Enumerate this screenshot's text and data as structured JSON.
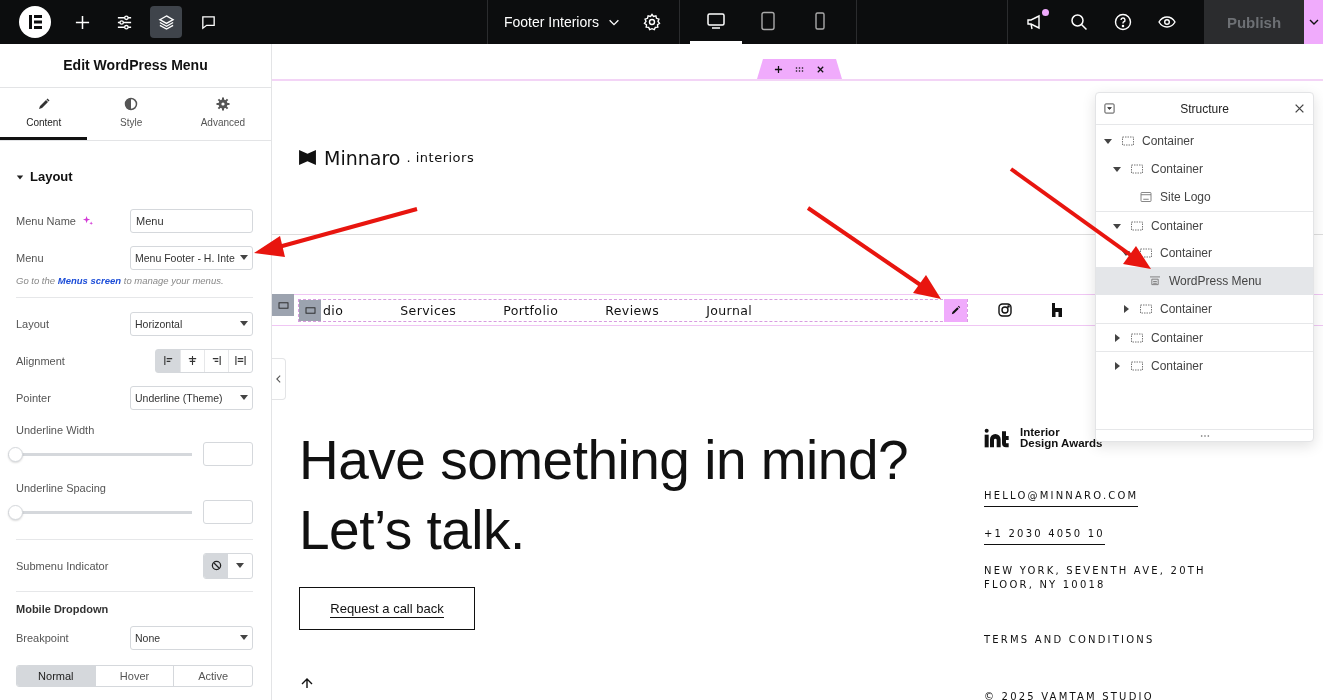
{
  "topbar": {
    "tools": [
      {
        "kind": "add",
        "selected": false
      },
      {
        "kind": "settings",
        "selected": false
      },
      {
        "kind": "layers",
        "selected": true
      },
      {
        "kind": "comments",
        "selected": false
      }
    ],
    "document": {
      "title": "Footer Interiors"
    },
    "devices": [
      {
        "kind": "desktop",
        "selected": true
      },
      {
        "kind": "tablet",
        "selected": false
      },
      {
        "kind": "mobile",
        "selected": false
      }
    ],
    "whats_new": {
      "unread": true
    },
    "publish": {
      "label": "Publish",
      "disabled": true
    }
  },
  "panel": {
    "title": "Edit WordPress Menu",
    "tabs": [
      {
        "label": "Content",
        "kind": "content",
        "selected": true
      },
      {
        "label": "Style",
        "kind": "style",
        "selected": false
      },
      {
        "label": "Advanced",
        "kind": "advanced",
        "selected": false
      }
    ],
    "section": {
      "title": "Layout",
      "expanded": true
    },
    "groups": [
      [
        {
          "kind": "input",
          "label": "Menu Name",
          "ai": true,
          "value": "Menu"
        },
        {
          "kind": "select",
          "label": "Menu",
          "value": "Menu Footer - H. Inte"
        },
        {
          "kind": "hint",
          "before": "Go to the",
          "link": "Menus screen",
          "after": "to manage your menus."
        }
      ],
      [
        {
          "kind": "select",
          "label": "Layout",
          "value": "Horizontal"
        },
        {
          "kind": "align",
          "label": "Alignment",
          "options": [
            {
              "kind": "left",
              "selected": true
            },
            {
              "kind": "center",
              "selected": false
            },
            {
              "kind": "right",
              "selected": false
            },
            {
              "kind": "justify",
              "selected": false
            }
          ]
        },
        {
          "kind": "select",
          "label": "Pointer",
          "value": "Underline (Theme)"
        },
        {
          "kind": "slider",
          "label": "Underline Width",
          "level": 0
        },
        {
          "kind": "slider",
          "label": "Underline Spacing",
          "level": 0
        }
      ],
      [
        {
          "kind": "indicator",
          "label": "Submenu Indicator"
        }
      ],
      [
        {
          "kind": "heading",
          "label": "Mobile Dropdown"
        },
        {
          "kind": "select",
          "label": "Breakpoint",
          "value": "None"
        },
        {
          "kind": "segments",
          "options": [
            {
              "label": "Normal",
              "selected": true
            },
            {
              "label": "Hover",
              "selected": false
            },
            {
              "label": "Active",
              "selected": false
            }
          ]
        }
      ]
    ]
  },
  "site": {
    "logo": {
      "name": "Minnaro",
      "suffix": ". interiors"
    },
    "menu": {
      "items": [
        "dio",
        "Services",
        "Portfolio",
        "Reviews",
        "Journal"
      ],
      "socials": [
        {
          "kind": "instagram"
        },
        {
          "kind": "houzz"
        }
      ]
    },
    "headline": "Have something in mind? Let’s talk.",
    "cta": "Request a call back",
    "award": [
      "Interior",
      "Design Awards"
    ],
    "email": "HELLO@MINNARO.COM",
    "phone": "+1 2030 4050 10",
    "address": [
      "NEW YORK, SEVENTH AVE, 20TH",
      "FLOOR, NY 10018"
    ],
    "terms": "TERMS AND CONDITIONS",
    "copyright": "© 2025 VAMTAM STUDIO"
  },
  "structure": {
    "title": "Structure",
    "tree": [
      {
        "label": "Container",
        "kind": "container",
        "expanded": true,
        "selected": false,
        "children": [
          {
            "label": "Container",
            "kind": "container",
            "expanded": true,
            "selected": false,
            "children": [
              {
                "label": "Site Logo",
                "kind": "logo",
                "selected": false
              }
            ]
          },
          {
            "label": "Container",
            "kind": "container",
            "expanded": true,
            "selected": false,
            "children": [
              {
                "label": "Container",
                "kind": "container",
                "expanded": true,
                "selected": false,
                "children": [
                  {
                    "label": "WordPress Menu",
                    "kind": "menu",
                    "selected": true
                  }
                ]
              },
              {
                "label": "Container",
                "kind": "container",
                "expanded": false,
                "selected": false
              }
            ]
          },
          {
            "label": "Container",
            "kind": "container",
            "expanded": false,
            "selected": false
          },
          {
            "label": "Container",
            "kind": "container",
            "expanded": false,
            "selected": false
          }
        ]
      }
    ]
  }
}
